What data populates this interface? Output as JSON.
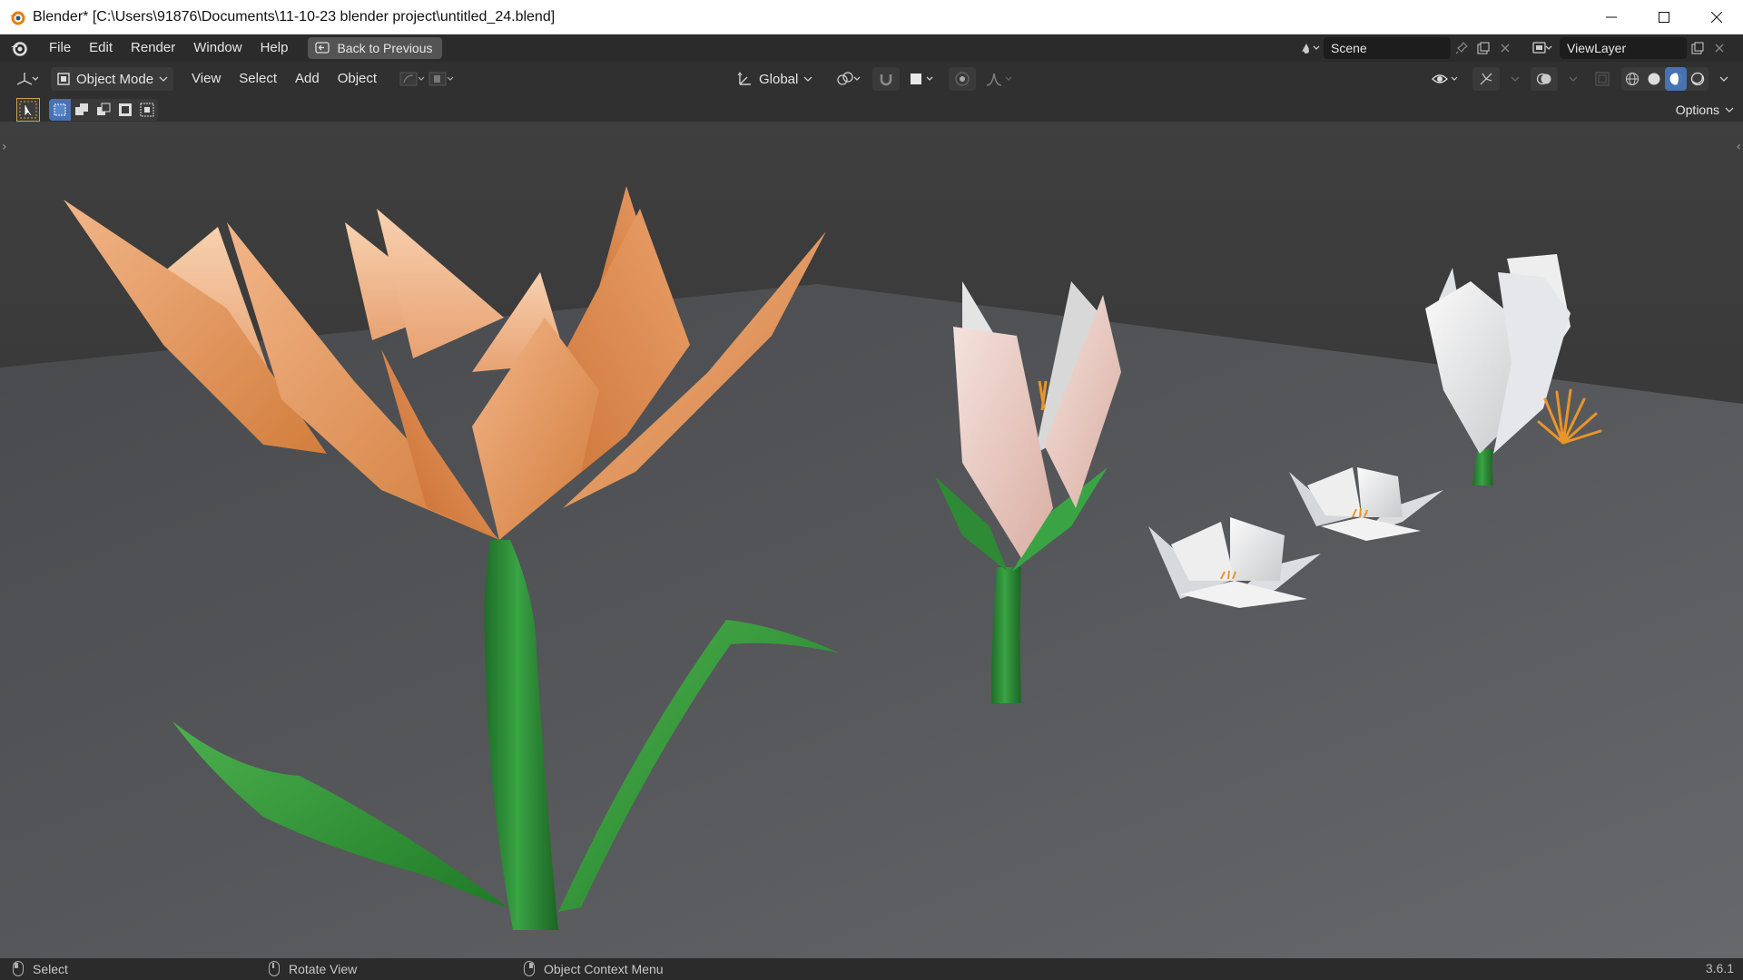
{
  "window": {
    "title": "Blender* [C:\\Users\\91876\\Documents\\11-10-23 blender project\\untitled_24.blend]",
    "controls": [
      "minimize",
      "maximize",
      "close"
    ]
  },
  "topbar": {
    "menus": [
      "File",
      "Edit",
      "Render",
      "Window",
      "Help"
    ],
    "back_button": "Back to Previous",
    "scene": "Scene",
    "view_layer": "ViewLayer"
  },
  "header": {
    "editor_type_icon": "view3d-icon",
    "mode": "Object Mode",
    "menus": [
      "View",
      "Select",
      "Add",
      "Object"
    ],
    "orientation": "Global",
    "active_shading": "material-preview"
  },
  "toolrow": {
    "options_label": "Options"
  },
  "statusbar": {
    "left_mouse": "Select",
    "middle_mouse": "Rotate View",
    "right_mouse": "Object Context Menu",
    "version": "3.6.1"
  },
  "colors": {
    "accent": "#4772b3",
    "orange_petal": "#e09050",
    "stem_green": "#2e8a34",
    "white_petal": "#e8e8ea"
  }
}
